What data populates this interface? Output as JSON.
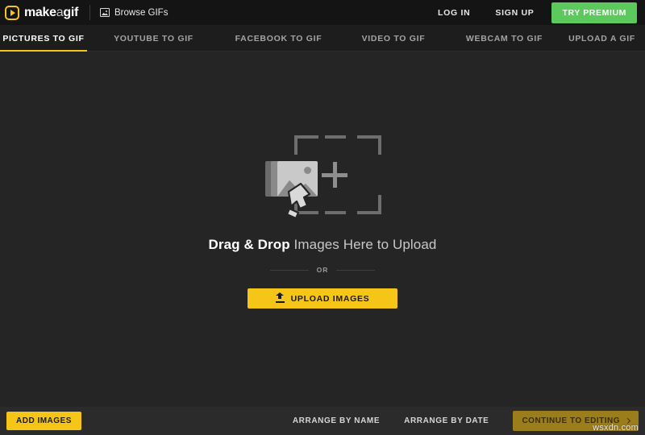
{
  "header": {
    "logo": {
      "prefix": "make",
      "middle": "a",
      "suffix": "gif",
      "icon": "play-logo-icon"
    },
    "browse_gifs": {
      "label": "Browse GIFs",
      "icon": "image-icon"
    },
    "login_label": "LOG IN",
    "signup_label": "SIGN UP",
    "premium_label": "TRY PREMIUM",
    "premium_color": "#5CC95C"
  },
  "tabs": [
    {
      "label": "PICTURES TO GIF",
      "active": true
    },
    {
      "label": "YOUTUBE TO GIF",
      "active": false
    },
    {
      "label": "FACEBOOK TO GIF",
      "active": false
    },
    {
      "label": "VIDEO TO GIF",
      "active": false
    },
    {
      "label": "WEBCAM TO GIF",
      "active": false
    },
    {
      "label": "UPLOAD A GIF",
      "active": false
    }
  ],
  "dropzone": {
    "icon": "image-stack-add-icon",
    "title_bold": "Drag & Drop",
    "title_rest": " Images Here to Upload",
    "or_label": "OR",
    "upload_button_label": "UPLOAD IMAGES",
    "upload_button_icon": "upload-icon",
    "accent_color": "#F5C518"
  },
  "footer": {
    "add_images_label": "ADD IMAGES",
    "arrange_by_name_label": "ARRANGE BY NAME",
    "arrange_by_date_label": "ARRANGE BY DATE",
    "continue_label": "CONTINUE TO EDITING",
    "continue_icon": "chevron-right-icon",
    "continue_disabled_color": "#9B7D1B"
  },
  "watermark": {
    "text": "wsxdn.com"
  }
}
